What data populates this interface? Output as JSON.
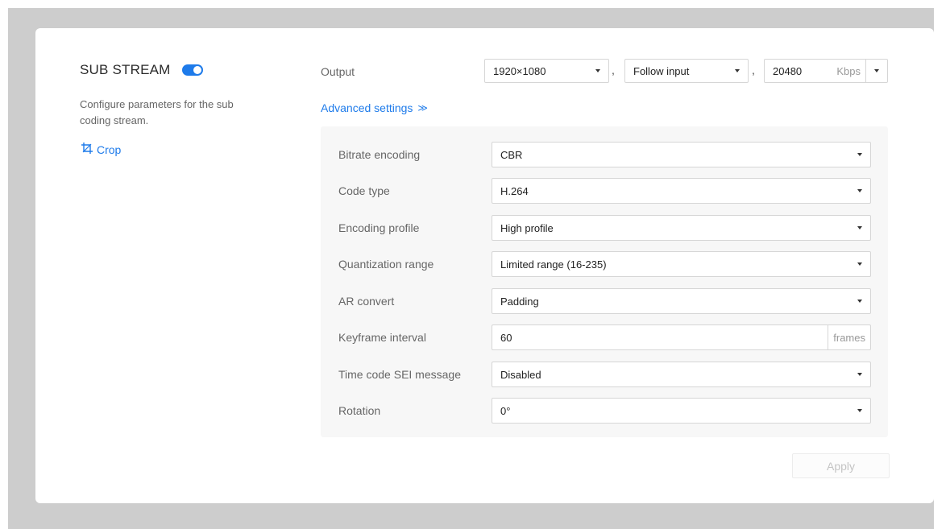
{
  "stream": {
    "title": "SUB STREAM",
    "enabled": true,
    "description": "Configure parameters for the sub coding stream.",
    "crop_label": "Crop"
  },
  "output": {
    "label": "Output",
    "resolution": "1920×1080",
    "framerate": "Follow input",
    "bitrate": "20480",
    "bitrate_unit": "Kbps",
    "separator": ","
  },
  "advanced": {
    "label": "Advanced settings",
    "chevron": "≫",
    "rows": [
      {
        "label": "Bitrate encoding",
        "value": "CBR"
      },
      {
        "label": "Code type",
        "value": "H.264"
      },
      {
        "label": "Encoding profile",
        "value": "High profile"
      },
      {
        "label": "Quantization range",
        "value": "Limited range (16-235)"
      },
      {
        "label": "AR convert",
        "value": "Padding"
      },
      {
        "label": "Keyframe interval",
        "value": "60",
        "unit": "frames"
      },
      {
        "label": "Time code SEI message",
        "value": "Disabled"
      },
      {
        "label": "Rotation",
        "value": "0°"
      }
    ]
  },
  "apply_label": "Apply",
  "colors": {
    "accent": "#1e7bea",
    "backdrop": "#cdcdcd",
    "panel": "#f7f7f7"
  }
}
